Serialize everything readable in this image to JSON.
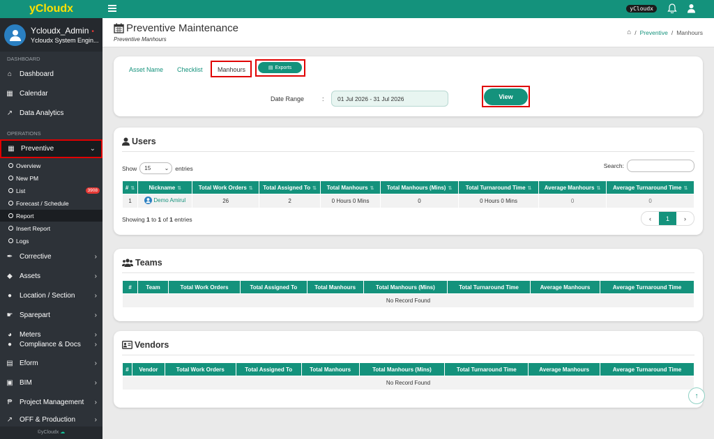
{
  "app": {
    "logo": "yCloudx",
    "brand_pill": "yCloudx"
  },
  "user": {
    "name": "Ycloudx_Admin",
    "role": "Ycloudx System Engin...",
    "status_dot": "•"
  },
  "sidebar": {
    "sections": [
      "DASHBOARD",
      "OPERATIONS"
    ],
    "dashboard_items": [
      "Dashboard",
      "Calendar",
      "Data Analytics"
    ],
    "preventive": "Preventive",
    "sub_items": [
      "Overview",
      "New PM",
      "List",
      "Forecast / Schedule",
      "Report",
      "Insert Report",
      "Logs"
    ],
    "list_badge": "3908",
    "other_items": [
      "Corrective",
      "Assets",
      "Location / Section",
      "Sparepart",
      "Meters",
      "Compliance & Docs",
      "Eform",
      "BIM",
      "Project Management",
      "OFF & Production"
    ],
    "footer": "©yCloudx"
  },
  "header": {
    "title": "Preventive Maintenance",
    "subtitle": "Preventive Manhours",
    "breadcrumb": [
      "Preventive",
      "Manhours"
    ]
  },
  "tabs": {
    "asset_name": "Asset Name",
    "checklist": "Checklist",
    "manhours": "Manhours",
    "exports": "Exports"
  },
  "filter": {
    "date_label": "Date Range",
    "colon": ":",
    "date_value": "01 Jul 2026 - 31 Jul 2026",
    "view": "View"
  },
  "users": {
    "title": "Users",
    "show": "Show",
    "entries_value": "15",
    "entries": "entries",
    "search": "Search:",
    "columns": [
      "#",
      "Nickname",
      "Total Work Orders",
      "Total Assigned To",
      "Total Manhours",
      "Total Manhours (Mins)",
      "Total Turnaround Time",
      "Average Manhours",
      "Average Turnaround Time"
    ],
    "rows": [
      [
        "1",
        "Demo Amirul",
        "26",
        "2",
        "0 Hours 0 Mins",
        "0",
        "0 Hours 0 Mins",
        "0",
        "0"
      ]
    ],
    "showing_pre": "Showing ",
    "showing_a": "1",
    "showing_mid1": " to ",
    "showing_b": "1",
    "showing_mid2": " of ",
    "showing_c": "1",
    "showing_post": " entries",
    "page": "1"
  },
  "teams": {
    "title": "Teams",
    "columns": [
      "#",
      "Team",
      "Total Work Orders",
      "Total Assigned To",
      "Total Manhours",
      "Total Manhours (Mins)",
      "Total Turnaround Time",
      "Average Manhours",
      "Average Turnaround Time"
    ],
    "empty": "No Record Found"
  },
  "vendors": {
    "title": "Vendors",
    "columns": [
      "#",
      "Vendor",
      "Total Work Orders",
      "Total Assigned To",
      "Total Manhours",
      "Total Manhours (Mins)",
      "Total Turnaround Time",
      "Average Manhours",
      "Average Turnaround Time"
    ],
    "empty": "No Record Found"
  },
  "colors": {
    "accent": "#14927c",
    "sidebar": "#2d3238",
    "highlight": "#e00000",
    "logo_text": "#ffe000"
  }
}
